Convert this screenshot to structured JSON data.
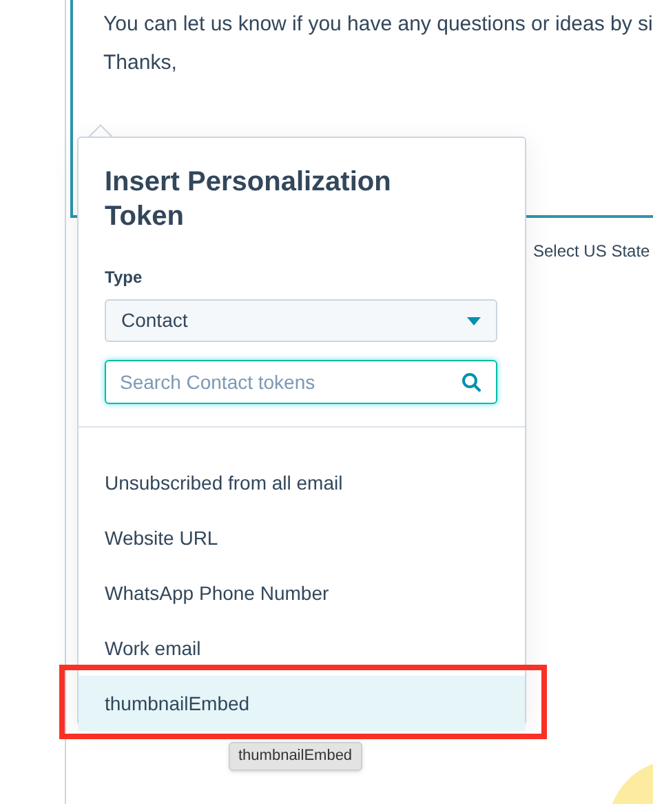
{
  "editor": {
    "lines": [
      "You can let us know if you have any questions or ideas by si",
      "Thanks,"
    ]
  },
  "field_label": "Select US State",
  "popover": {
    "title": "Insert Personalization Token",
    "type_label": "Type",
    "type_select": {
      "value": "Contact"
    },
    "search": {
      "placeholder": "Search Contact tokens"
    },
    "tokens": [
      {
        "label": "Unsubscribed from all email",
        "selected": false,
        "annotated": false
      },
      {
        "label": "Website URL",
        "selected": false,
        "annotated": false
      },
      {
        "label": "WhatsApp Phone Number",
        "selected": false,
        "annotated": false
      },
      {
        "label": "Work email",
        "selected": false,
        "annotated": false
      },
      {
        "label": "thumbnailEmbed",
        "selected": true,
        "annotated": true
      }
    ]
  },
  "tooltip": "thumbnailEmbed"
}
